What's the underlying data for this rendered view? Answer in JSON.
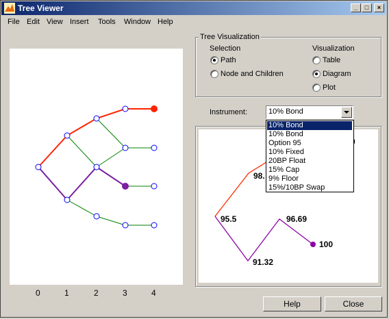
{
  "window": {
    "title": "Tree Viewer",
    "min_glyph": "_",
    "max_glyph": "□",
    "close_glyph": "×"
  },
  "menu": [
    {
      "label": "File"
    },
    {
      "label": "Edit"
    },
    {
      "label": "View"
    },
    {
      "label": "Insert"
    },
    {
      "label": "Tools"
    },
    {
      "label": "Window"
    },
    {
      "label": "Help"
    }
  ],
  "tree_plot": {
    "x_ticks": [
      "0",
      "1",
      "2",
      "3",
      "4"
    ]
  },
  "tree_visualization": {
    "title": "Tree Visualization",
    "selection": {
      "heading": "Selection",
      "options": [
        "Path",
        "Node and Children"
      ],
      "selected": "Path"
    },
    "visualization": {
      "heading": "Visualization",
      "options": [
        "Table",
        "Diagram",
        "Plot"
      ],
      "selected": "Diagram"
    }
  },
  "instrument": {
    "label": "Instrument:",
    "value": "10% Bond",
    "options": [
      "10% Bond",
      "10% Bond",
      "Option 95",
      "10% Fixed",
      "20BP Float",
      "15% Cap",
      "9% Floor",
      "15%/10BP Swap"
    ],
    "highlighted_index": 0
  },
  "diagram": {
    "labels": {
      "start": "95.5",
      "upper": "98.",
      "top_right": "0",
      "low": "91.32",
      "mid": "96.69",
      "end": "100"
    },
    "colors": {
      "upper_path": "#ff2a00",
      "lower_path": "#8b00a6"
    }
  },
  "buttons": {
    "help": "Help",
    "close": "Close"
  },
  "colors": {
    "tree_highlight": "#ff2200",
    "tree_selected": "#7a1fa2",
    "tree_edge": "#008000",
    "tree_node": "#0000ff",
    "title_bar": "#0a246a"
  }
}
